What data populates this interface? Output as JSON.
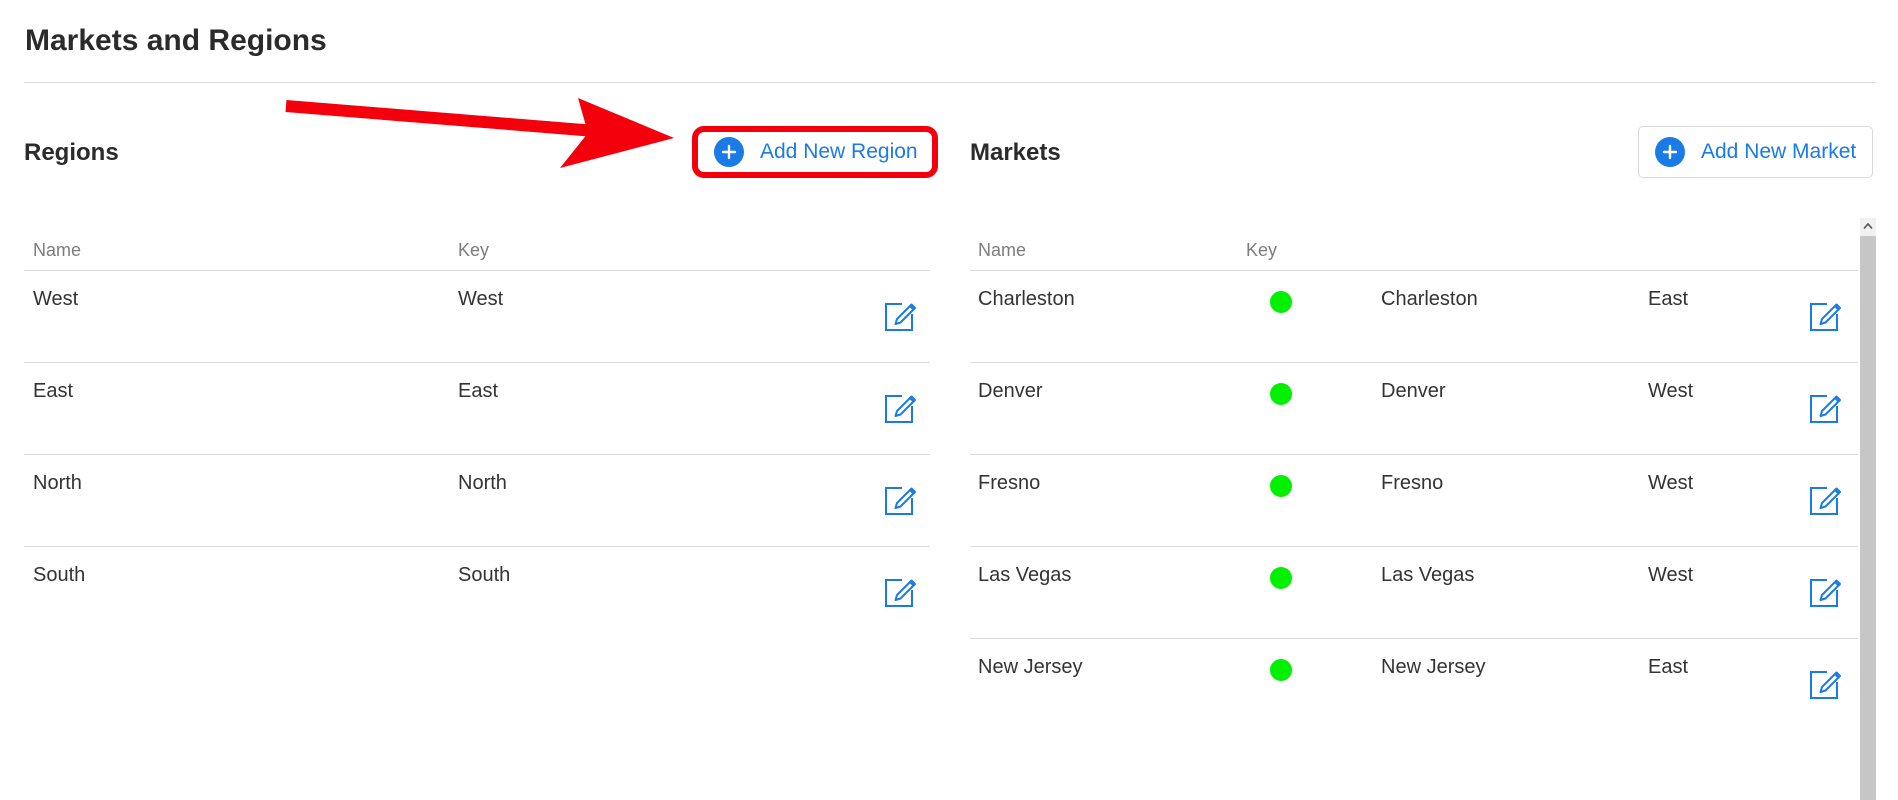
{
  "page": {
    "title": "Markets and Regions"
  },
  "regions": {
    "title": "Regions",
    "add_button_label": "Add New Region",
    "columns": [
      "Name",
      "Key"
    ],
    "rows": [
      {
        "name": "West",
        "key": "West"
      },
      {
        "name": "East",
        "key": "East"
      },
      {
        "name": "North",
        "key": "North"
      },
      {
        "name": "South",
        "key": "South"
      }
    ]
  },
  "markets": {
    "title": "Markets",
    "add_button_label": "Add New Market",
    "columns": [
      "Name",
      "Key"
    ],
    "rows": [
      {
        "name": "Charleston",
        "key": "Charleston",
        "region": "East"
      },
      {
        "name": "Denver",
        "key": "Denver",
        "region": "West"
      },
      {
        "name": "Fresno",
        "key": "Fresno",
        "region": "West"
      },
      {
        "name": "Las Vegas",
        "key": "Las Vegas",
        "region": "West"
      },
      {
        "name": "New Jersey",
        "key": "New Jersey",
        "region": "East"
      }
    ]
  },
  "colors": {
    "accent": "#1a7ae6",
    "highlight": "#f4000c",
    "status_active": "#00f000"
  },
  "icons": {
    "add": "plus-circle-icon",
    "edit": "edit-icon",
    "status": "status-dot-icon",
    "annotation": "red-arrow-icon"
  }
}
